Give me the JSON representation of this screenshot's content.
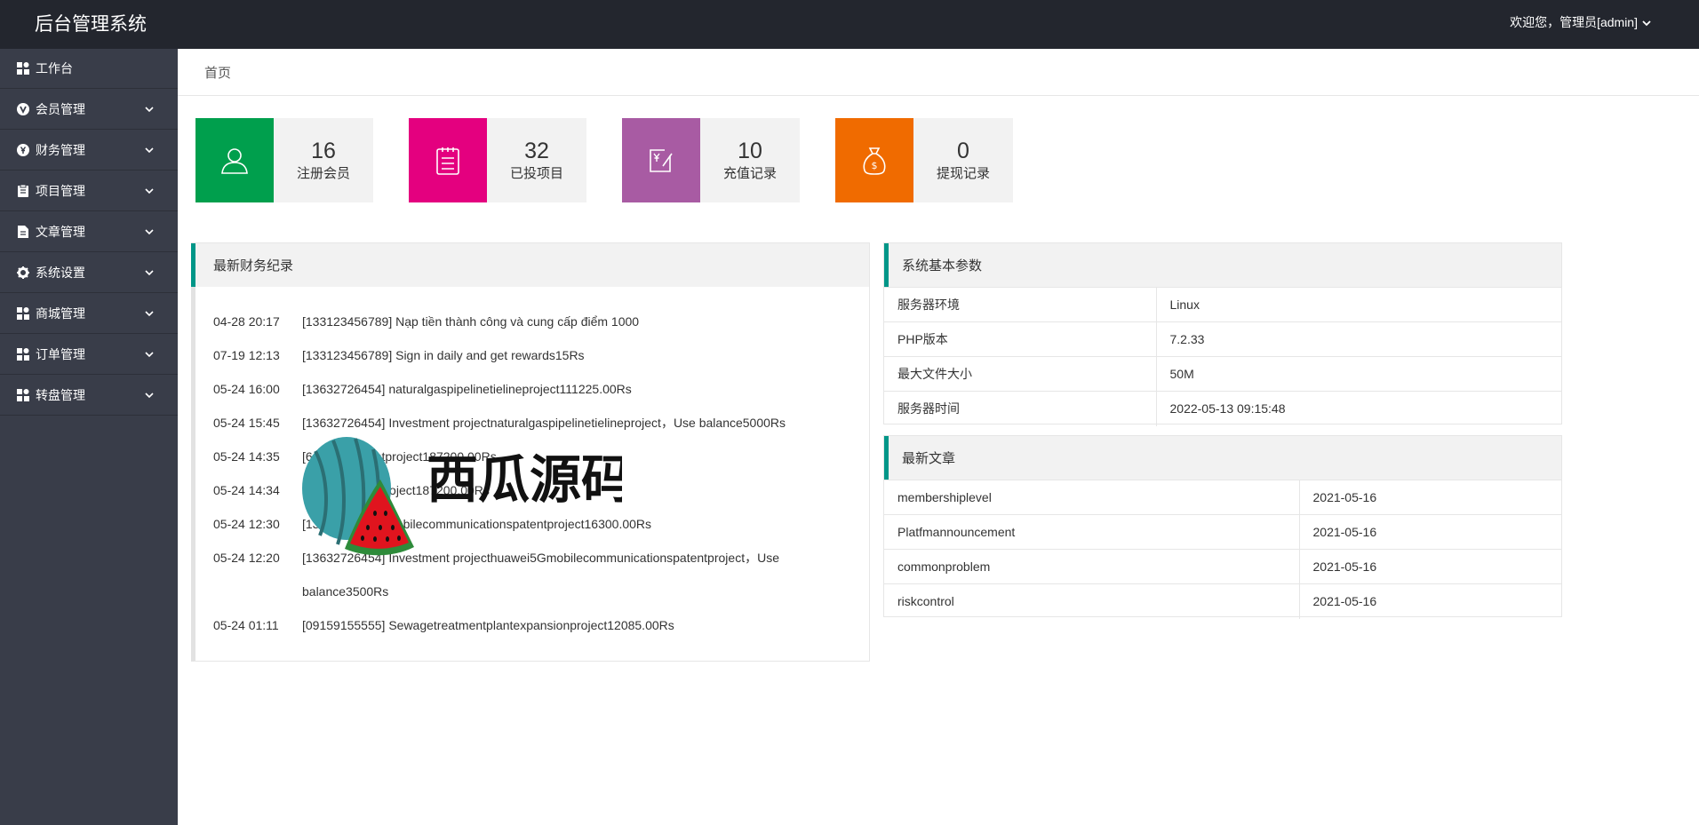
{
  "header": {
    "brand": "后台管理系统",
    "user_label": "欢迎您，管理员[admin]"
  },
  "sidebar": {
    "items": [
      {
        "label": "工作台",
        "icon": "dashboard-icon",
        "has_children": false
      },
      {
        "label": "会员管理",
        "icon": "member-icon",
        "has_children": true
      },
      {
        "label": "财务管理",
        "icon": "finance-icon",
        "has_children": true
      },
      {
        "label": "项目管理",
        "icon": "project-icon",
        "has_children": true
      },
      {
        "label": "文章管理",
        "icon": "article-icon",
        "has_children": true
      },
      {
        "label": "系统设置",
        "icon": "gear-icon",
        "has_children": true
      },
      {
        "label": "商城管理",
        "icon": "shop-icon",
        "has_children": true
      },
      {
        "label": "订单管理",
        "icon": "order-icon",
        "has_children": true
      },
      {
        "label": "转盘管理",
        "icon": "wheel-icon",
        "has_children": true
      }
    ]
  },
  "breadcrumb": "首页",
  "stats": [
    {
      "value": "16",
      "label": "注册会员",
      "color": "#009f4d",
      "icon": "user-icon"
    },
    {
      "value": "32",
      "label": "已投项目",
      "color": "#e4007f",
      "icon": "clipboard-icon"
    },
    {
      "value": "10",
      "label": "充值记录",
      "color": "#a85ba3",
      "icon": "recharge-icon"
    },
    {
      "value": "0",
      "label": "提现记录",
      "color": "#f06b00",
      "icon": "money-bag-icon"
    }
  ],
  "finance_panel": {
    "title": "最新财务纪录",
    "rows": [
      {
        "time": "04-28 20:17",
        "text": "[133123456789] Nạp tiền thành công và cung cấp điểm 1000"
      },
      {
        "time": "07-19 12:13",
        "text": "[133123456789] Sign in daily and get rewards15Rs"
      },
      {
        "time": "05-24 16:00",
        "text": "[13632726454] naturalgaspipelinetielineproject111225.00Rs"
      },
      {
        "time": "05-24 15:45",
        "text": "[13632726454] Investment projectnaturalgaspipelinetielineproject，Use balance5000Rs"
      },
      {
        "time": "05-24 14:35",
        "text": "[6          ] Powerplantproject187200.00Rs"
      },
      {
        "time": "05-24 14:34",
        "text": "[           ] Powerplantproject187200.00Rs"
      },
      {
        "time": "05-24 12:30",
        "text": "[13         ] huawei5Gmobilecommunicationspatentproject16300.00Rs"
      },
      {
        "time": "05-24 12:20",
        "text": "[13632726454] Investment projecthuawei5Gmobilecommunicationspatentproject，Use balance3500Rs"
      },
      {
        "time": "05-24 01:11",
        "text": "[09159155555] Sewagetreatmentplantexpansionproject12085.00Rs"
      }
    ]
  },
  "sys_panel": {
    "title": "系统基本参数",
    "rows": [
      {
        "key": "服务器环境",
        "value": "Linux"
      },
      {
        "key": "PHP版本",
        "value": "7.2.33"
      },
      {
        "key": "最大文件大小",
        "value": "50M"
      },
      {
        "key": "服务器时间",
        "value": "2022-05-13 09:15:48"
      }
    ]
  },
  "article_panel": {
    "title": "最新文章",
    "rows": [
      {
        "title": "membershiplevel",
        "date": "2021-05-16"
      },
      {
        "title": "Platfmannouncement",
        "date": "2021-05-16"
      },
      {
        "title": "commonproblem",
        "date": "2021-05-16"
      },
      {
        "title": "riskcontrol",
        "date": "2021-05-16"
      }
    ]
  },
  "watermark_text": "西瓜源码"
}
